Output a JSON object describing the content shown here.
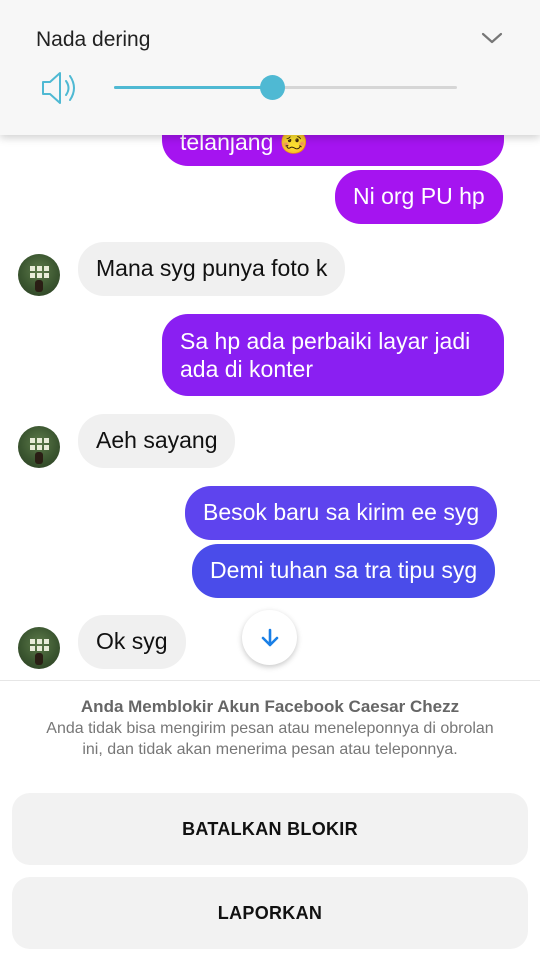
{
  "volume": {
    "title": "Nada dering",
    "level_fraction": 0.46,
    "accent_color": "#4fb9d3",
    "speaker_icon": "speaker-icon",
    "collapse_icon": "chevron-down-icon"
  },
  "chat": {
    "messages": [
      {
        "sender": "me",
        "text": "telanjang 🥴"
      },
      {
        "sender": "me",
        "text": "Ni org PU hp"
      },
      {
        "sender": "them",
        "text": "Mana syg punya foto k"
      },
      {
        "sender": "me",
        "text": "Sa hp ada perbaiki layar jadi ada di konter"
      },
      {
        "sender": "them",
        "text": "Aeh sayang"
      },
      {
        "sender": "me",
        "text": "Besok baru sa kirim ee syg"
      },
      {
        "sender": "me",
        "text": "Demi tuhan sa tra tipu syg"
      },
      {
        "sender": "them",
        "text": "Ok syg"
      }
    ],
    "scroll_down_icon": "arrow-down-icon",
    "outgoing_colors": [
      "#a514f0",
      "#8a1ff2",
      "#7a2af0",
      "#5e44ee",
      "#4a4cea"
    ]
  },
  "block_notice": {
    "title": "Anda Memblokir Akun Facebook Caesar Chezz",
    "description": "Anda tidak bisa mengirim pesan atau meneleponnya di obrolan ini, dan tidak akan menerima pesan atau teleponnya.",
    "unblock_label": "BATALKAN BLOKIR",
    "report_label": "LAPORKAN"
  }
}
